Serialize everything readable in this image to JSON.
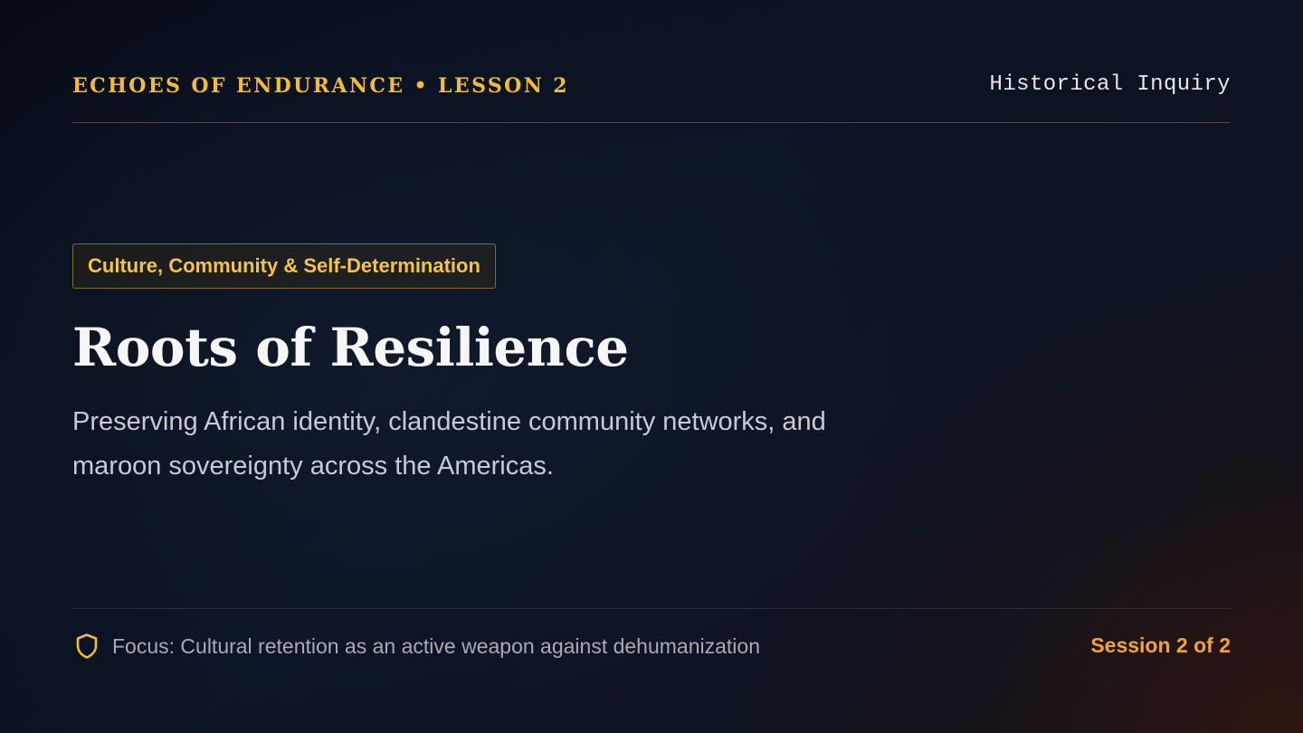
{
  "header": {
    "series_title": "ECHOES OF ENDURANCE • LESSON 2",
    "tag": "Historical Inquiry"
  },
  "main": {
    "topic_badge": "Culture, Community & Self-Determination",
    "title": "Roots of Resilience",
    "subtitle": "Preserving African identity, clandestine community networks, and maroon sovereignty across the Americas."
  },
  "footer": {
    "focus_icon": "shield-icon",
    "focus_text": "Focus: Cultural retention as an active weapon against dehumanization",
    "session": "Session 2 of 2"
  },
  "colors": {
    "accent_gold": "#f2bd35",
    "accent_orange": "#f3a52b",
    "background": "#0c1424"
  }
}
